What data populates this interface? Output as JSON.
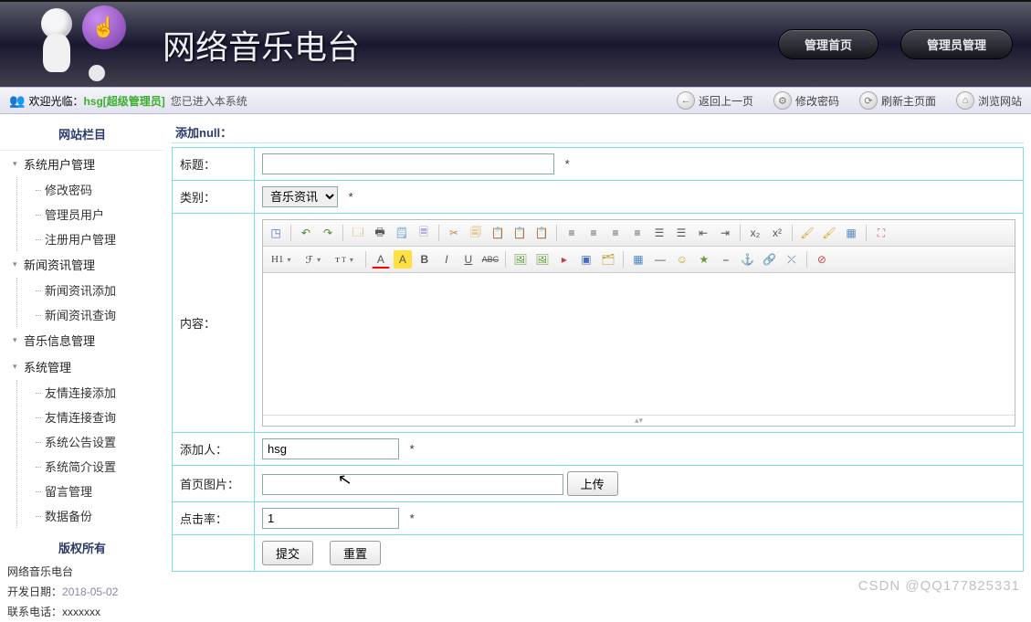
{
  "header": {
    "site_title": "网络音乐电台",
    "btn_home": "管理首页",
    "btn_admin": "管理员管理"
  },
  "welcome": {
    "prefix": "欢迎光临：",
    "username": "hsg[超级管理员]",
    "entered": "您已进入本系统",
    "actions": {
      "back": "返回上一页",
      "pass": "修改密码",
      "refresh": "刷新主页面",
      "browse": "浏览网站"
    }
  },
  "sidebar": {
    "title": "网站栏目",
    "groups": [
      {
        "label": "系统用户管理",
        "items": [
          "修改密码",
          "管理员用户",
          "注册用户管理"
        ]
      },
      {
        "label": "新闻资讯管理",
        "items": [
          "新闻资讯添加",
          "新闻资讯查询"
        ]
      },
      {
        "label": "音乐信息管理",
        "items": []
      },
      {
        "label": "系统管理",
        "items": [
          "友情连接添加",
          "友情连接查询",
          "系统公告设置",
          "系统简介设置",
          "留言管理",
          "数据备份"
        ]
      }
    ],
    "copyright": "版权所有",
    "footer": {
      "site": "网络音乐电台",
      "dev_date_label": "开发日期：",
      "dev_date": "2018-05-02",
      "contact_label": "联系电话：",
      "contact": "xxxxxxx"
    }
  },
  "form": {
    "panel_title": "添加null：",
    "labels": {
      "title": "标题：",
      "category": "类别：",
      "content": "内容：",
      "adder": "添加人：",
      "cover": "首页图片：",
      "clicks": "点击率："
    },
    "required": "*",
    "title_value": "",
    "category_value": "音乐资讯",
    "adder_value": "hsg",
    "cover_value": "",
    "clicks_value": "1",
    "btn_upload": "上传",
    "btn_submit": "提交",
    "btn_reset": "重置"
  },
  "editor_toolbar": {
    "h1": "H1",
    "font": "ℱ",
    "size": "𝑇",
    "acolor": "A",
    "ahl": "A",
    "bold": "B",
    "italic": "I",
    "underline": "U",
    "strike": "ABC"
  },
  "watermark": "CSDN @QQ177825331"
}
